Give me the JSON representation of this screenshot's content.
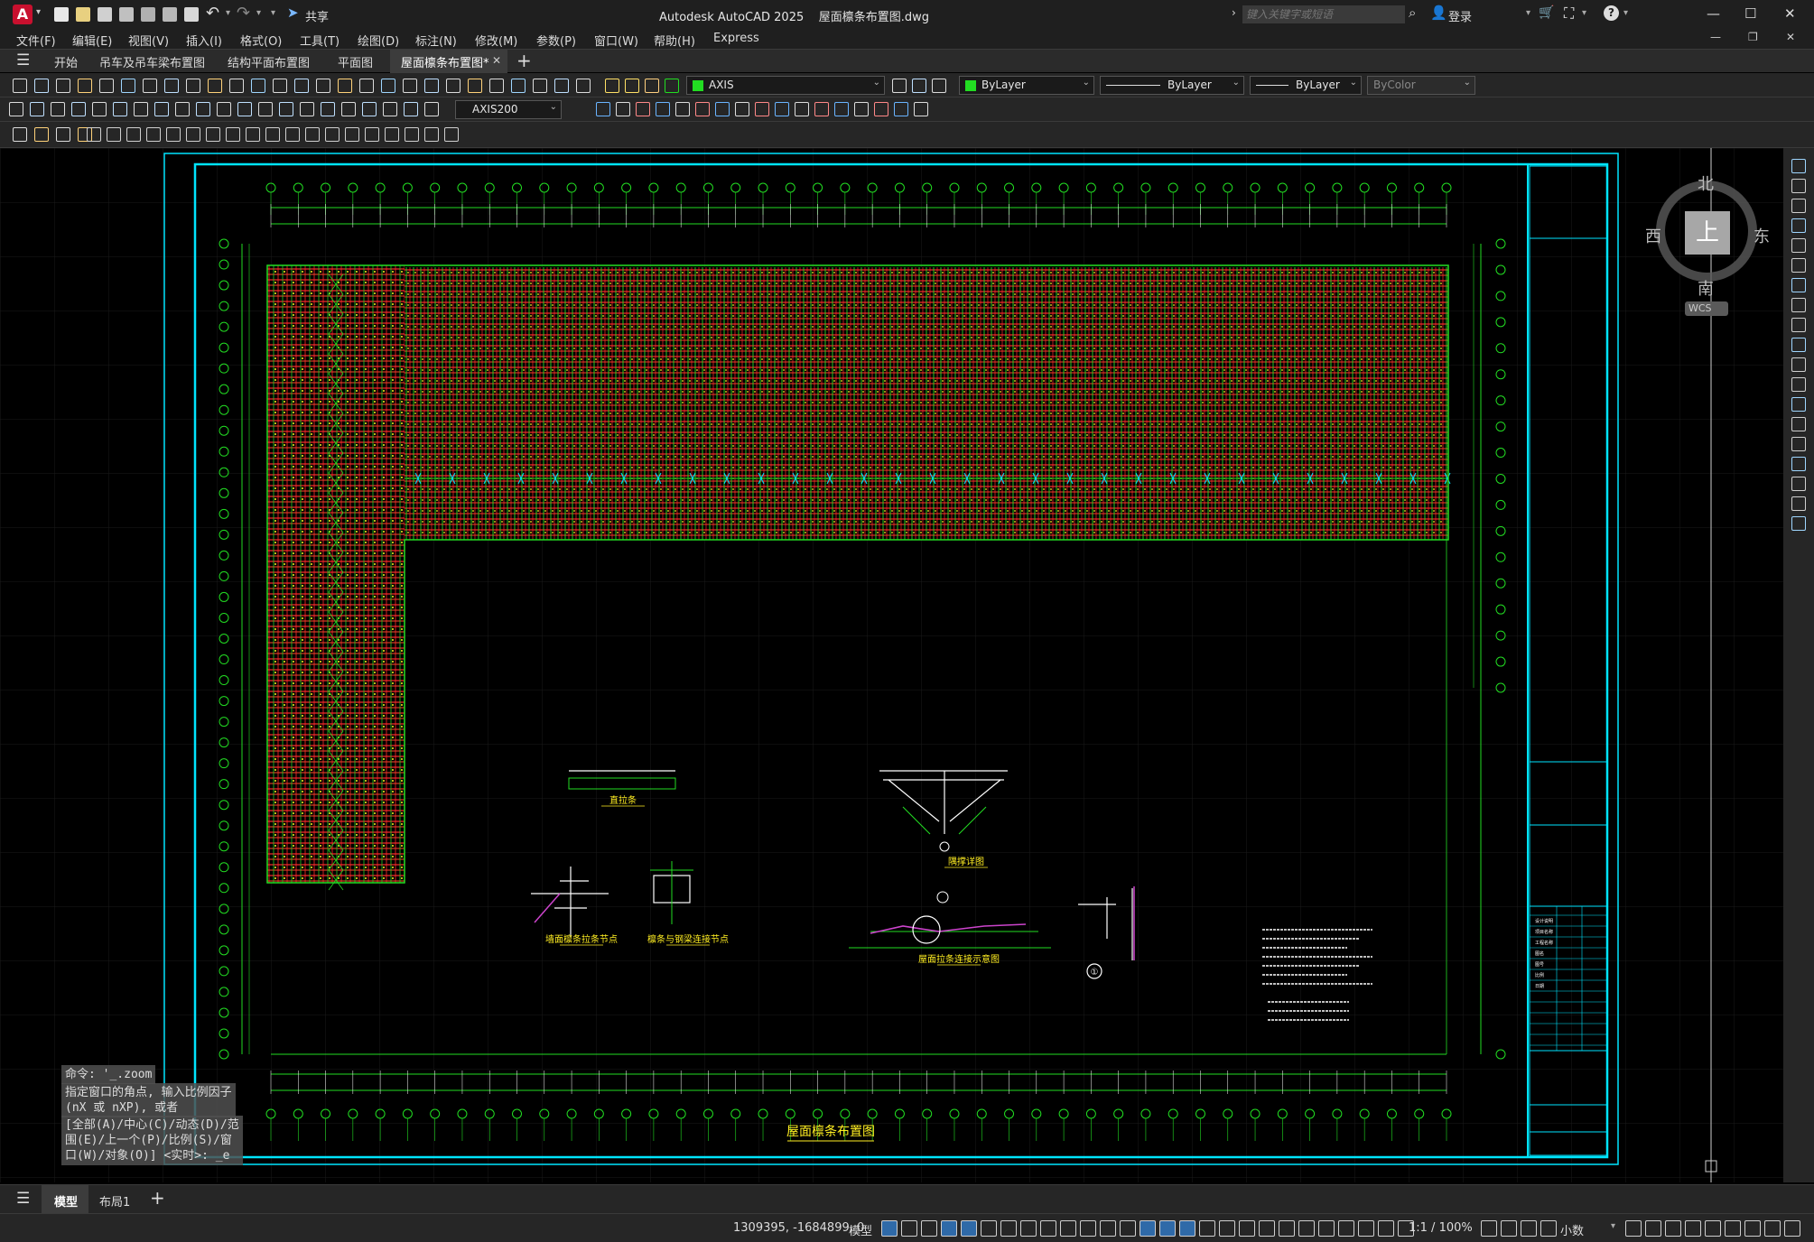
{
  "app": {
    "logo_letter": "A",
    "title": "Autodesk AutoCAD 2025    屋面檩条布置图.dwg",
    "share_label": "共享",
    "search_placeholder": "键入关键字或短语",
    "login_label": "登录"
  },
  "menu": [
    "文件(F)",
    "编辑(E)",
    "视图(V)",
    "插入(I)",
    "格式(O)",
    "工具(T)",
    "绘图(D)",
    "标注(N)",
    "修改(M)",
    "参数(P)",
    "窗口(W)",
    "帮助(H)",
    "Express"
  ],
  "tabs": [
    {
      "label": "开始",
      "active": false
    },
    {
      "label": "吊车及吊车梁布置图",
      "active": false
    },
    {
      "label": "结构平面布置图",
      "active": false
    },
    {
      "label": "平面图",
      "active": false
    },
    {
      "label": "屋面檩条布置图*",
      "active": true
    }
  ],
  "toolbar": {
    "layer_name": "AXIS",
    "color": "ByLayer",
    "linetype": "ByLayer",
    "lineweight": "ByLayer",
    "plotstyle": "ByColor",
    "dimstyle": "AXIS200"
  },
  "viewcube": {
    "north": "北",
    "south": "南",
    "east": "东",
    "west": "西",
    "face": "上",
    "wcs": "WCS"
  },
  "drawing": {
    "main_title": "屋面檩条布置图",
    "detail_labels": [
      "直拉条",
      "隅撑详图",
      "墙面檩条拉条节点",
      "檩条与钢梁连接节点",
      "屋面拉条连接示意图"
    ],
    "detail_symbol": "①",
    "title_block_notes": [
      "设计说明",
      "项目名称",
      "工程名称",
      "图名",
      "图号",
      "比例",
      "日期"
    ]
  },
  "command": {
    "line1": "命令: '_.zoom",
    "line2": "指定窗口的角点, 输入比例因子\n(nX 或 nXP), 或者",
    "line3": "[全部(A)/中心(C)/动态(D)/范\n围(E)/上一个(P)/比例(S)/窗\n口(W)/对象(O)] <实时>: _e"
  },
  "layouts": [
    {
      "label": "模型",
      "active": true
    },
    {
      "label": "布局1",
      "active": false
    }
  ],
  "status": {
    "coords": "1309395, -1684899, 0",
    "space": "模型",
    "scale": "1:1 / 100%",
    "units": "小数"
  },
  "colors": {
    "frame": "#00e5ff",
    "grid_green": "#22dd22",
    "purlin_red": "#ff2a2a",
    "bracing_yellow": "#ffee22"
  }
}
